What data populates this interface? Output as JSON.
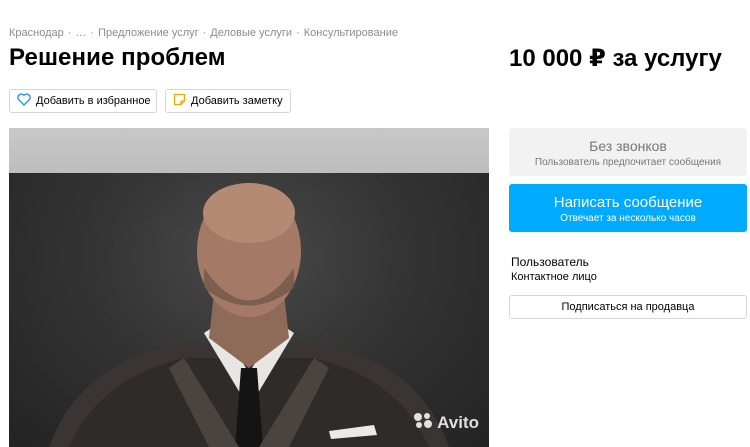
{
  "breadcrumb": {
    "items": [
      "Краснодар",
      "…",
      "Предложение услуг",
      "Деловые услуги",
      "Консультирование"
    ]
  },
  "listing": {
    "title": "Решение проблем",
    "price": "10 000 ₽ за услугу"
  },
  "actions": {
    "favorite_label": "Добавить в избранное",
    "note_label": "Добавить заметку"
  },
  "photo": {
    "watermark": "Avito"
  },
  "contact": {
    "no_calls_title": "Без звонков",
    "no_calls_subtitle": "Пользователь предпочитает сообщения",
    "message_title": "Написать сообщение",
    "message_subtitle": "Отвечает за несколько часов"
  },
  "seller": {
    "name": "Пользователь",
    "role": "Контактное лицо",
    "subscribe_label": "Подписаться на продавца"
  },
  "colors": {
    "accent": "#00aaff",
    "muted_text": "#8c8c8c",
    "panel_gray": "#f2f2f2"
  },
  "icons": {
    "favorite": "heart-icon",
    "note": "note-icon",
    "watermark": "avito-logo-icon"
  }
}
